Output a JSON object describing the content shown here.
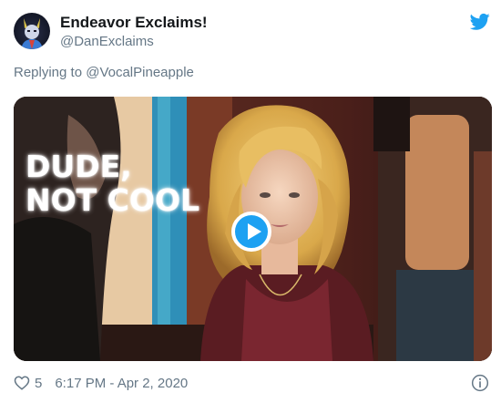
{
  "tweet": {
    "display_name": "Endeavor Exclaims!",
    "handle": "@DanExclaims",
    "reply_prefix": "Replying to ",
    "reply_to": "@VocalPineapple",
    "media_caption": "DUDE,\nNOT COOL",
    "like_count": "5",
    "timestamp": "6:17 PM - Apr 2, 2020"
  },
  "icons": {
    "brand": "twitter-bird-icon",
    "like": "heart-icon",
    "play": "play-icon",
    "info": "info-icon"
  },
  "colors": {
    "brand_blue": "#1da1f2",
    "text_primary": "#14171a",
    "text_secondary": "#657786"
  }
}
